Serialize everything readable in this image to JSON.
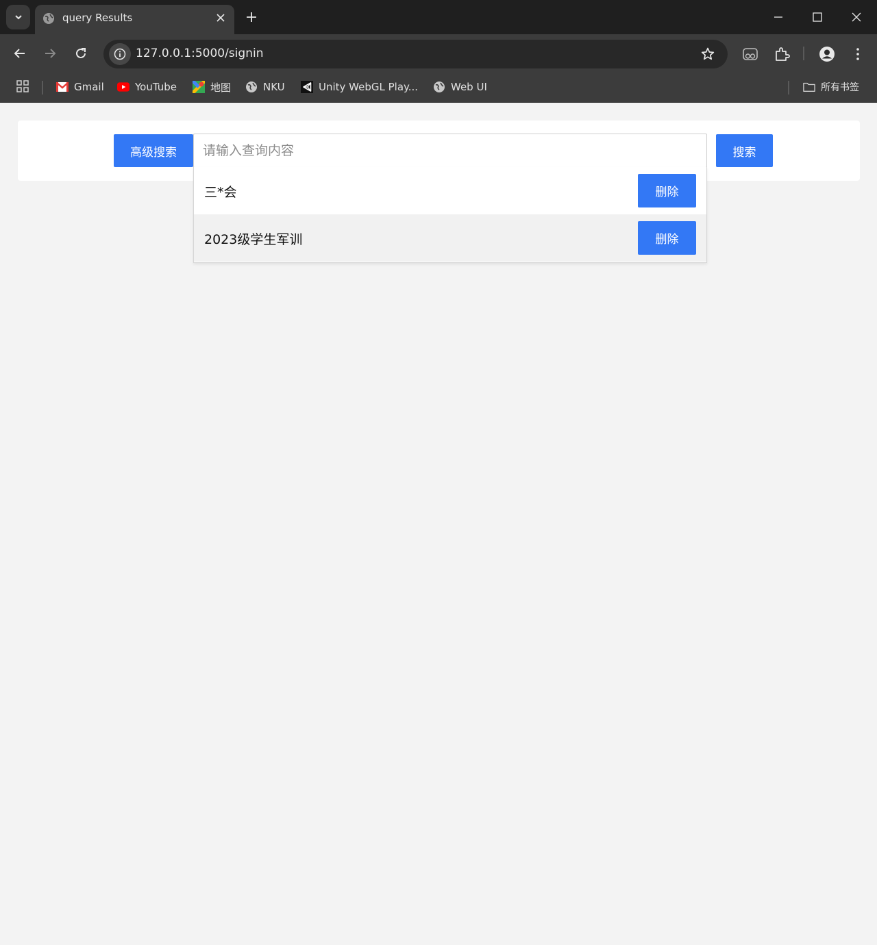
{
  "browser": {
    "tab_title": "query Results",
    "url": "127.0.0.1:5000/signin",
    "bookmarks": [
      {
        "label": "Gmail",
        "icon": "gmail-icon"
      },
      {
        "label": "YouTube",
        "icon": "youtube-icon"
      },
      {
        "label": "地图",
        "icon": "maps-icon"
      },
      {
        "label": "NKU",
        "icon": "globe-icon"
      },
      {
        "label": "Unity WebGL Play...",
        "icon": "unity-icon"
      },
      {
        "label": "Web UI",
        "icon": "globe-icon"
      }
    ],
    "all_bookmarks_label": "所有书签"
  },
  "search": {
    "advanced_label": "高级搜索",
    "placeholder": "请输入查询内容",
    "value": "",
    "search_label": "搜索"
  },
  "history": [
    {
      "text": "三*会",
      "delete_label": "删除"
    },
    {
      "text": "2023级学生军训",
      "delete_label": "删除"
    }
  ],
  "colors": {
    "accent": "#3378f5",
    "page_bg": "#f3f3f3",
    "chrome_dark": "#1f1f1f",
    "chrome_toolbar": "#3c3c3c"
  }
}
